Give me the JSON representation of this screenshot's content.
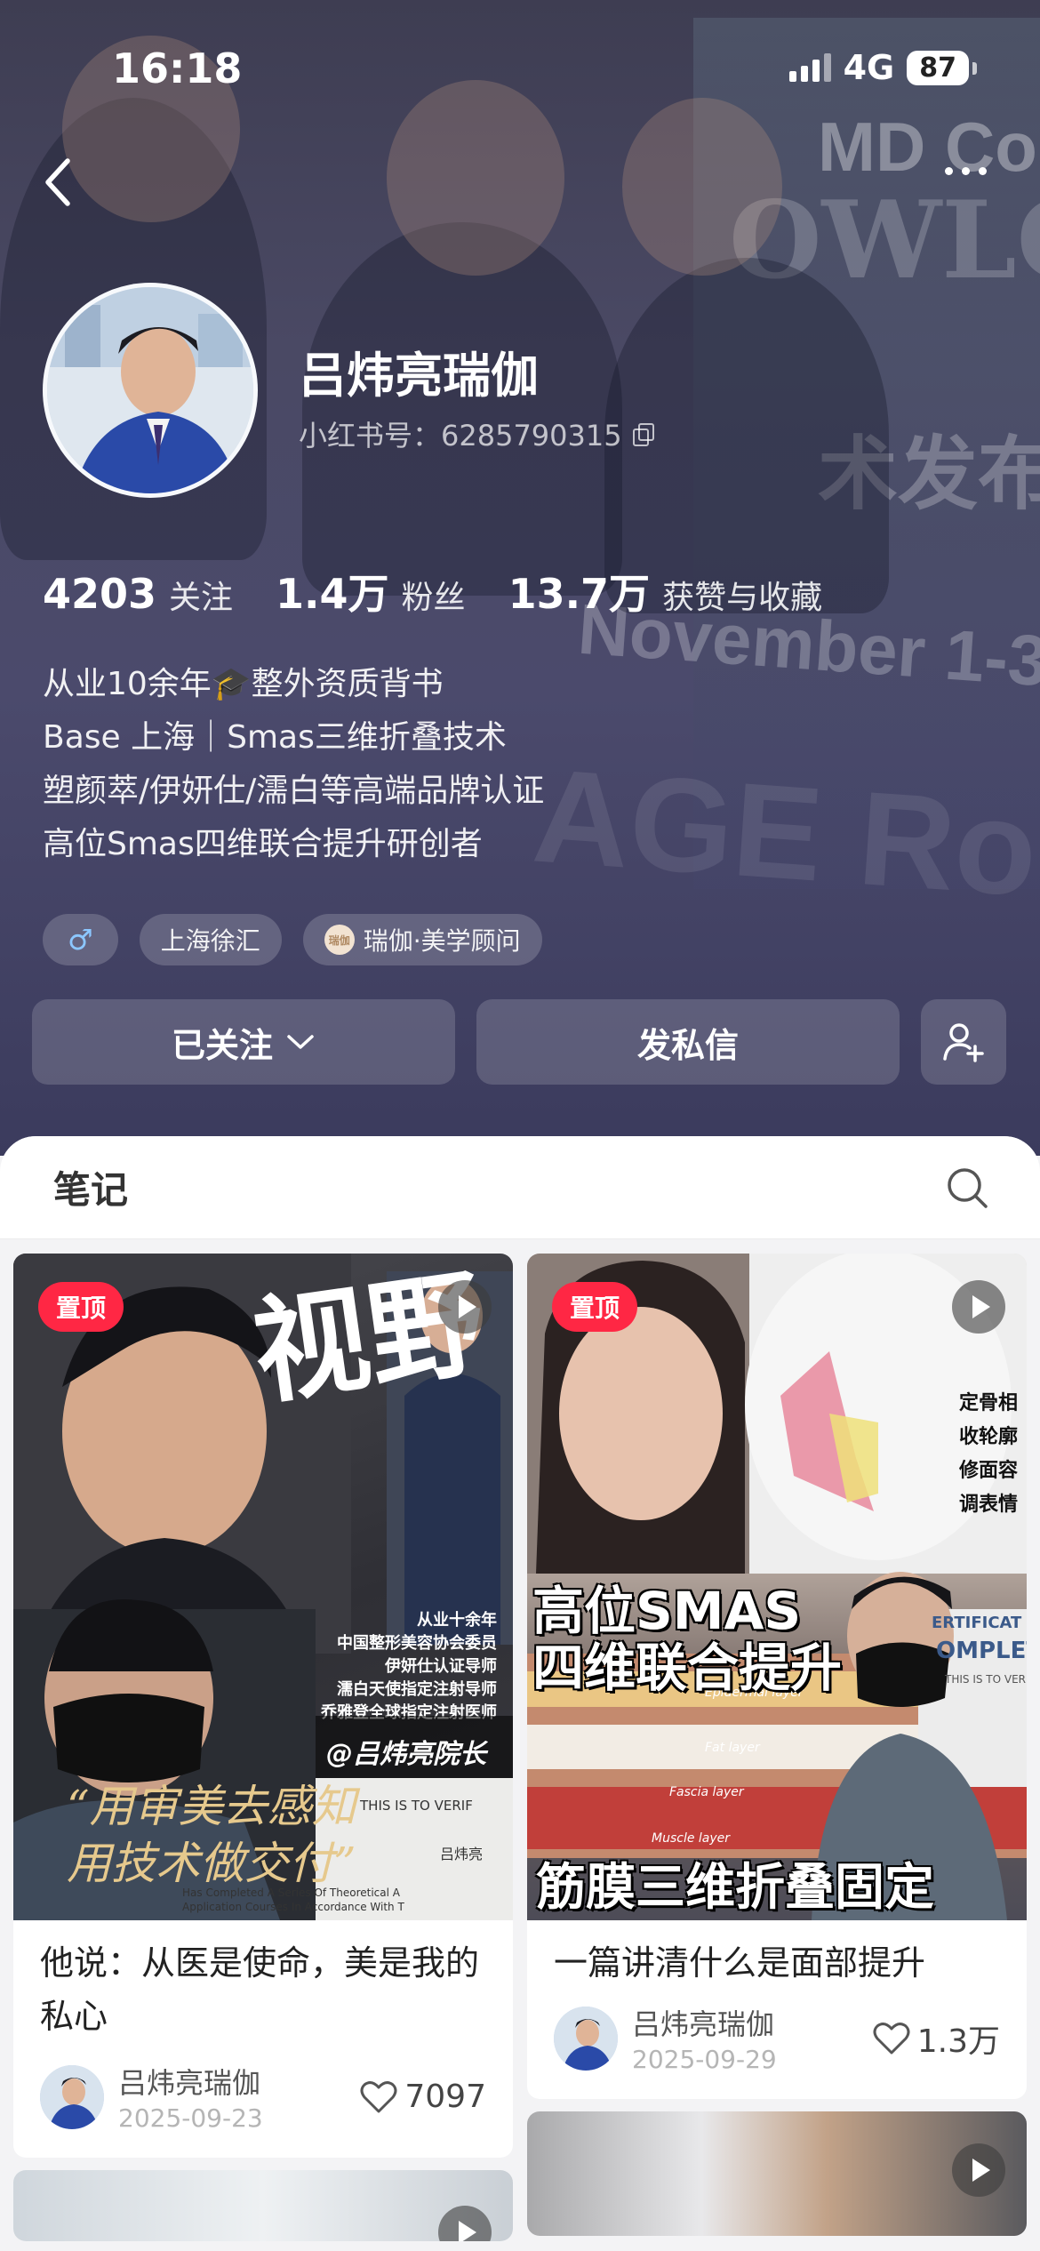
{
  "status_bar": {
    "time": "16:18",
    "network": "4G",
    "battery": "87"
  },
  "profile": {
    "name": "吕炜亮瑞伽",
    "xhs_id": "小红书号：6285790315",
    "stats": [
      {
        "value": "4203",
        "label": "关注"
      },
      {
        "value": "1.4万",
        "label": "粉丝"
      },
      {
        "value": "13.7万",
        "label": "获赞与收藏"
      }
    ],
    "bio": [
      "从业10余年🎓整外资质背书",
      "Base 上海｜Smas三维折叠技术",
      "塑颜萃/伊妍仕/濡白等高端品牌认证",
      "高位Smas四维联合提升研创者"
    ],
    "tags": {
      "gender": "♂",
      "location": "上海徐汇",
      "brand": "瑞伽·美学顾问",
      "brand_logo_text": "瑞伽"
    },
    "actions": {
      "follow": "已关注",
      "message": "发私信"
    }
  },
  "hero_background": {
    "board_text_1": "MD Codes",
    "board_text_2": "OWLO",
    "board_text_3": "术发布",
    "banner_text_1": "November 1-3",
    "banner_text_2": "AGE Ro"
  },
  "notes": {
    "tab_label": "笔记",
    "cards": [
      {
        "pin": "置顶",
        "title": "他说：从医是使命，美是我的私心",
        "author": "吕炜亮瑞伽",
        "date": "2025-09-23",
        "likes": "7097",
        "cover": {
          "script": "视野",
          "lines": [
            "从业十余年",
            "中国整形美容协会委员",
            "伊妍仕认证导师",
            "濡白天使指定注射导师",
            "乔雅登全球指定注射医师"
          ],
          "handle": "@吕炜亮院长",
          "quote_1": "“用审美去感知",
          "quote_2": "用技术做交付”",
          "cert_1": "THIS IS TO VERIF",
          "cert_name": "吕炜亮",
          "cert_2": "Has Completed A Series Of Theoretical A",
          "cert_3": "Application Courses In Accordance With T"
        }
      },
      {
        "pin": "置顶",
        "title": "一篇讲清什么是面部提升",
        "author": "吕炜亮瑞伽",
        "date": "2025-09-29",
        "likes": "1.3万",
        "cover": {
          "title_1": "高位SMAS",
          "title_2": "四维联合提升",
          "bottom": "筋膜三维折叠固定",
          "face_labels": [
            "定骨相",
            "收轮廓",
            "修面容",
            "调表情"
          ],
          "layers": [
            "Epidermal layer",
            "Fat layer",
            "Fascia layer",
            "Muscle layer"
          ],
          "cert_1": "ERTIFICAT",
          "cert_2": "OMPLET",
          "cert_3": "THIS IS TO VER"
        }
      }
    ]
  },
  "colors": {
    "accent": "#ff2744",
    "header_bg": "#4a4964"
  }
}
